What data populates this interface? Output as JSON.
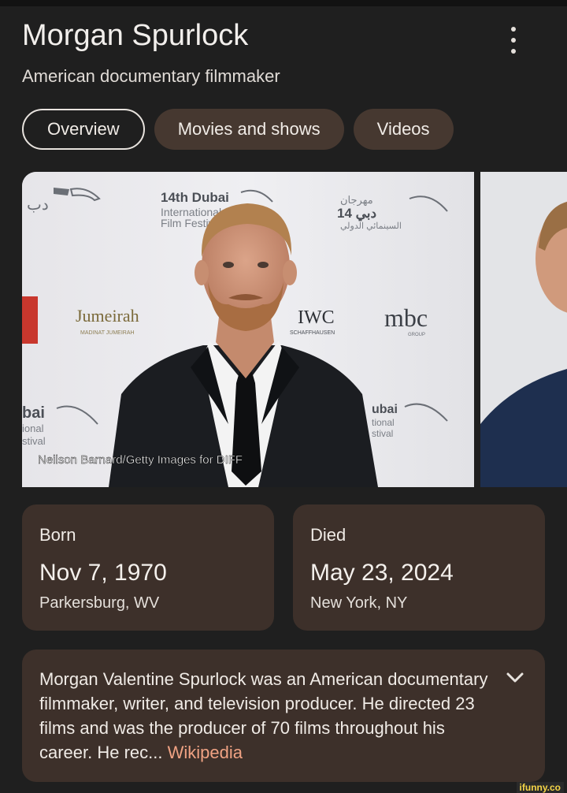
{
  "header": {
    "title": "Morgan Spurlock",
    "subtitle": "American documentary filmmaker",
    "more_icon": "kebab-menu-icon"
  },
  "tabs": [
    {
      "label": "Overview",
      "active": true
    },
    {
      "label": "Movies and shows",
      "active": false
    },
    {
      "label": "Videos",
      "active": false
    }
  ],
  "photo": {
    "credit": "Neilson Barnard/Getty Images for DIFF",
    "backdrop": {
      "dubai_line1": "14th Dubai",
      "dubai_line2": "International",
      "dubai_line3": "Film Festival",
      "arabic_top": "مهرجان",
      "arabic_mid": "14 دبي",
      "arabic_bottom": "السينمائي الدولي",
      "jumeirah": "Jumeirah",
      "jumeirah_sub": "MADINAT JUMEIRAH",
      "iwc": "IWC",
      "iwc_sub": "SCHAFFHAUSEN",
      "mbc": "mbc",
      "mbc_sub": "GROUP",
      "bottom_left_1": "bai",
      "bottom_left_2": "ional",
      "bottom_left_3": "stival",
      "bottom_right_1": "ubai",
      "bottom_right_2": "tional",
      "bottom_right_3": "stival"
    }
  },
  "facts": {
    "born": {
      "label": "Born",
      "date": "Nov 7, 1970",
      "place": "Parkersburg, WV"
    },
    "died": {
      "label": "Died",
      "date": "May 23, 2024",
      "place": "New York, NY"
    }
  },
  "summary": {
    "text": "Morgan Valentine Spurlock was an American documentary filmmaker, writer, and television producer. He directed 23 films and was the producer of 70 films throughout his career. He rec",
    "ellipsis": "... ",
    "source": "Wikipedia",
    "expand_icon": "chevron-down-icon"
  },
  "watermark": "ifunny.co",
  "colors": {
    "background": "#1f1f1f",
    "card": "#3d302a",
    "tab": "#463830",
    "link": "#f0a283"
  }
}
